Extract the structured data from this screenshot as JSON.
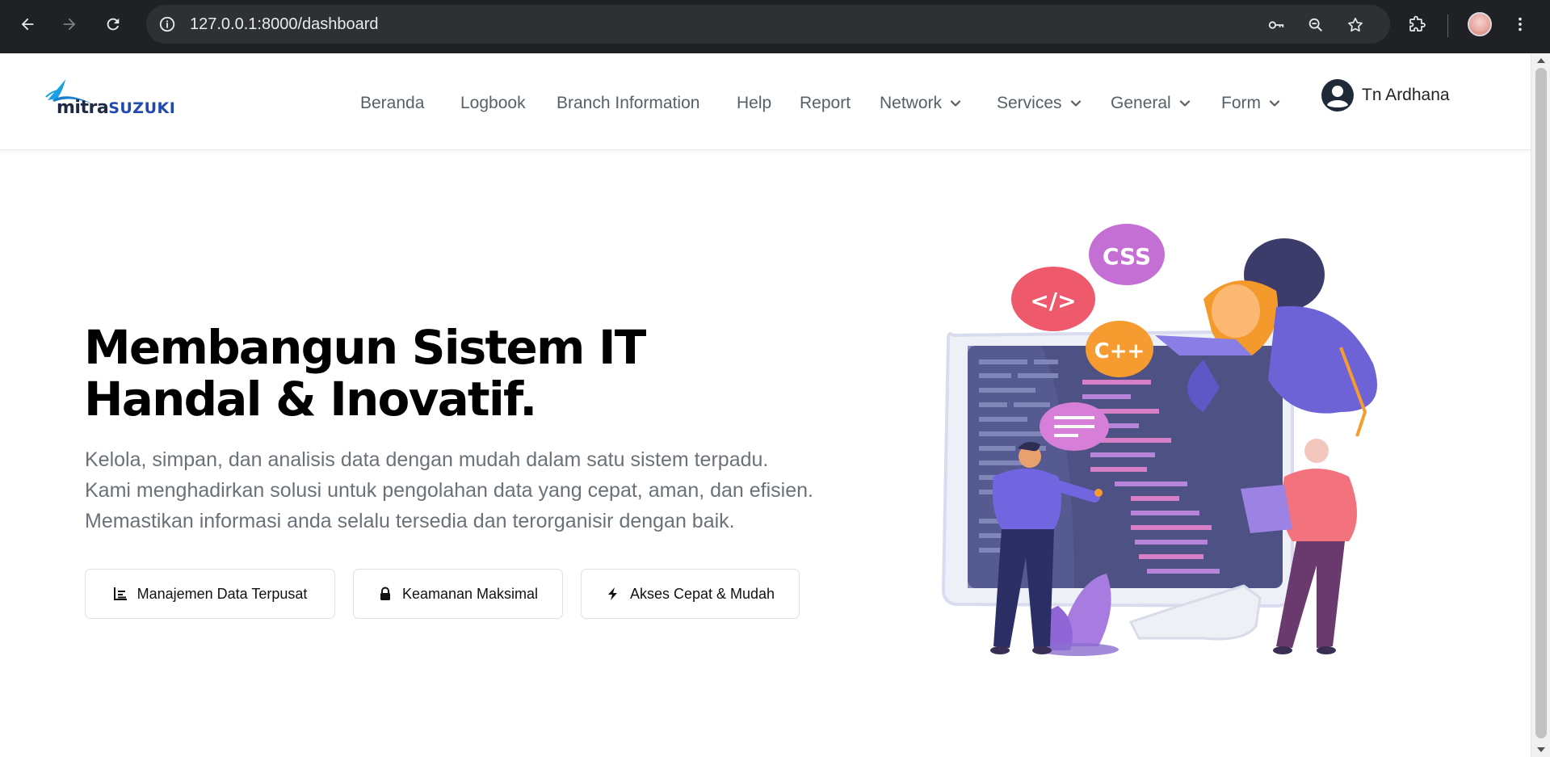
{
  "browser": {
    "url": "127.0.0.1:8000/dashboard"
  },
  "brand": {
    "name_part1": "mitra",
    "name_part2": "SUZUKI"
  },
  "nav": {
    "items": [
      {
        "label": "Beranda",
        "dropdown": false
      },
      {
        "label": "Logbook",
        "dropdown": false
      },
      {
        "label": "Branch Information",
        "dropdown": false
      },
      {
        "label": "Help",
        "dropdown": false
      },
      {
        "label": "Report",
        "dropdown": false
      },
      {
        "label": "Network",
        "dropdown": true
      },
      {
        "label": "Services",
        "dropdown": true
      },
      {
        "label": "General",
        "dropdown": true
      },
      {
        "label": "Form",
        "dropdown": true
      }
    ],
    "user_name": "Tn Ardhana"
  },
  "hero": {
    "title_line1": "Membangun Sistem IT",
    "title_line2": "Handal & Inovatif.",
    "description": "Kelola, simpan, dan analisis data dengan mudah dalam satu sistem terpadu. Kami menghadirkan solusi untuk pengolahan data yang cepat, aman, dan efisien. Memastikan informasi anda selalu tersedia dan terorganisir dengan baik.",
    "features": [
      {
        "label": "Manajemen Data Terpusat",
        "icon": "chart-icon"
      },
      {
        "label": "Keamanan Maksimal",
        "icon": "lock-icon"
      },
      {
        "label": "Akses Cepat & Mudah",
        "icon": "bolt-icon"
      }
    ]
  },
  "illustration": {
    "bubble_css": "CSS",
    "bubble_html": "</>",
    "bubble_cpp": "C++"
  }
}
